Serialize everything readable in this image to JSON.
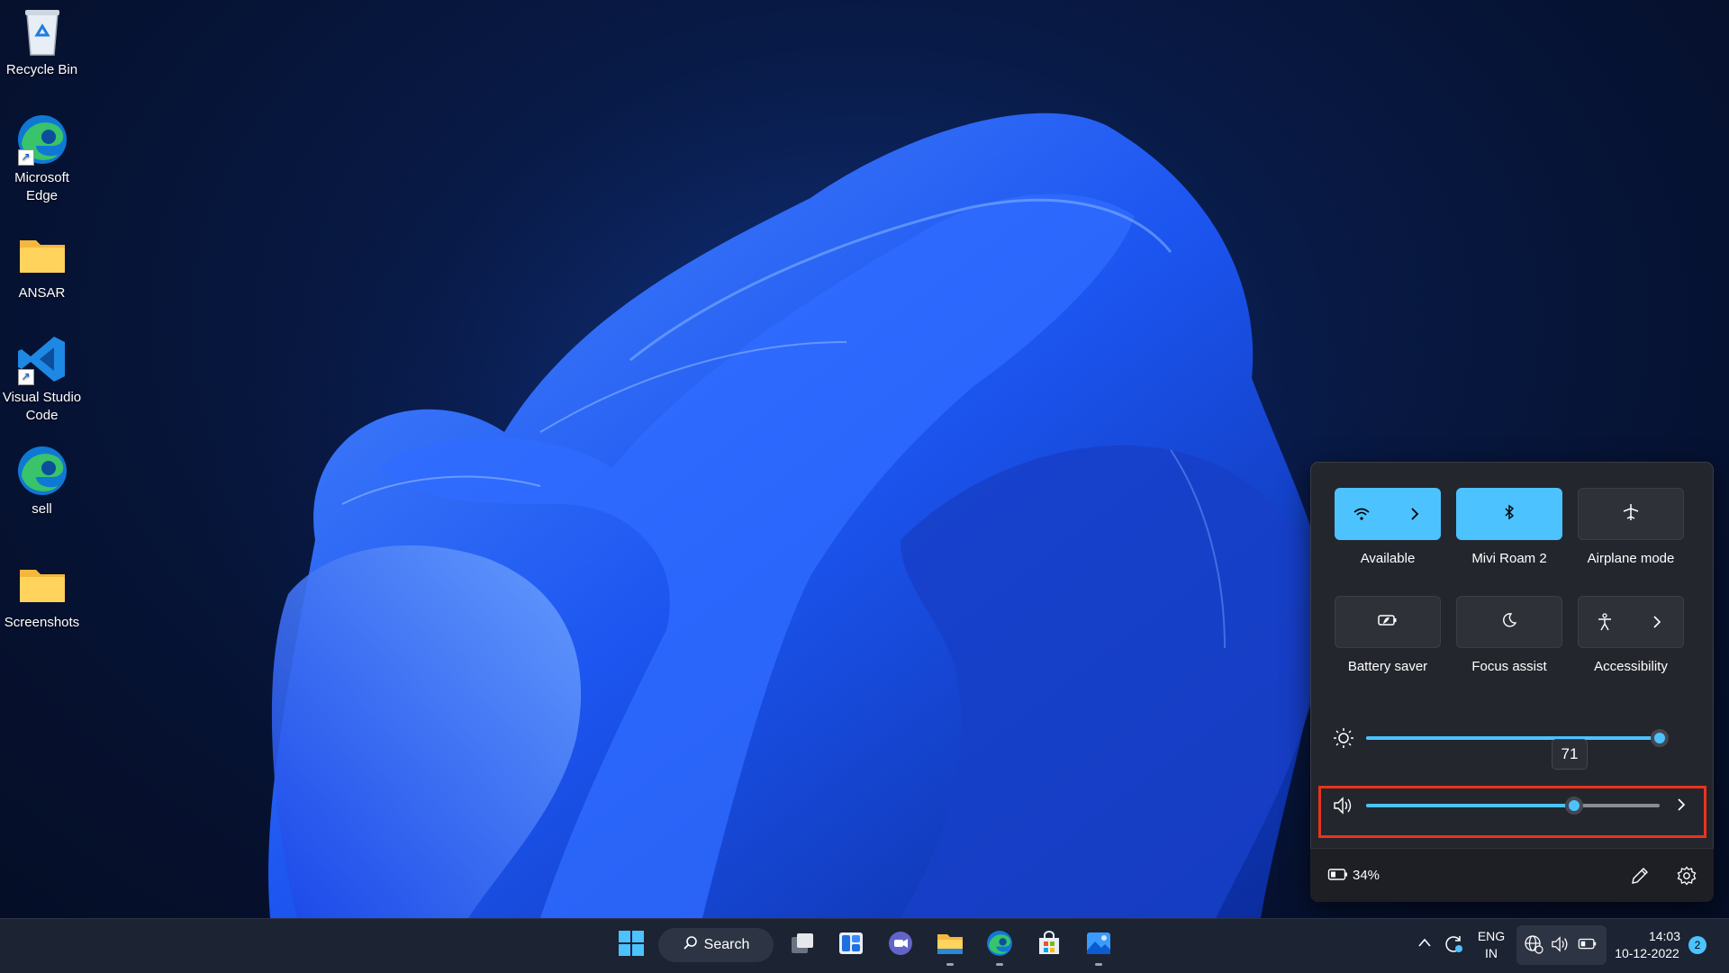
{
  "desktop": {
    "icons": [
      {
        "label": "Recycle Bin",
        "icon": "recycle-bin-icon"
      },
      {
        "label": "Microsoft Edge",
        "icon": "edge-icon"
      },
      {
        "label": "ANSAR",
        "icon": "folder-icon"
      },
      {
        "label": "Visual Studio Code",
        "icon": "vscode-icon"
      },
      {
        "label": "sell",
        "icon": "edge-icon"
      },
      {
        "label": "Screenshots",
        "icon": "folder-icon"
      }
    ]
  },
  "quick_settings": {
    "tiles": [
      {
        "label": "Available",
        "icon": "wifi-icon",
        "active": true,
        "has_chevron": true
      },
      {
        "label": "Mivi Roam 2",
        "icon": "bluetooth-icon",
        "active": true,
        "has_chevron": false
      },
      {
        "label": "Airplane mode",
        "icon": "airplane-icon",
        "active": false,
        "has_chevron": false
      },
      {
        "label": "Battery saver",
        "icon": "battery-saver-icon",
        "active": false,
        "has_chevron": false
      },
      {
        "label": "Focus assist",
        "icon": "moon-icon",
        "active": false,
        "has_chevron": false
      },
      {
        "label": "Accessibility",
        "icon": "accessibility-icon",
        "active": false,
        "has_chevron": true
      }
    ],
    "brightness": {
      "value": 100,
      "tooltip": "71",
      "icon": "sun-icon"
    },
    "volume": {
      "value": 71,
      "icon": "speaker-icon"
    },
    "battery_text": "34%",
    "accent_color": "#4cc2ff",
    "highlight_color": "#e8341c"
  },
  "taskbar": {
    "search_label": "Search",
    "apps": [
      "start-icon",
      "task-view-icon",
      "widgets-icon",
      "teams-chat-icon",
      "file-explorer-icon",
      "edge-icon",
      "store-icon",
      "photos-icon"
    ],
    "lang_line1": "ENG",
    "lang_line2": "IN",
    "time": "14:03",
    "date": "10-12-2022",
    "notification_count": "2"
  }
}
